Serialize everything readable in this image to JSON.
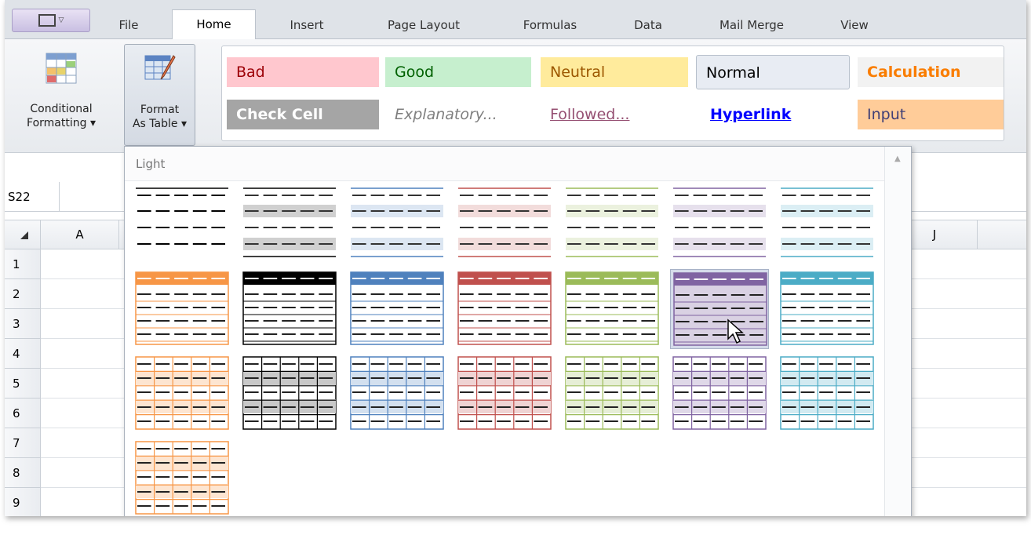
{
  "app_button": {
    "icon": "application-menu-icon"
  },
  "tabs": [
    {
      "label": "File",
      "active": false
    },
    {
      "label": "Home",
      "active": true
    },
    {
      "label": "Insert",
      "active": false
    },
    {
      "label": "Page Layout",
      "active": false
    },
    {
      "label": "Formulas",
      "active": false
    },
    {
      "label": "Data",
      "active": false
    },
    {
      "label": "Mail Merge",
      "active": false
    },
    {
      "label": "View",
      "active": false
    }
  ],
  "ribbon": {
    "conditional_formatting": {
      "line1": "Conditional",
      "line2": "Formatting ▾"
    },
    "format_as_table": {
      "line1": "Format",
      "line2": "As Table ▾"
    },
    "cell_styles": [
      {
        "label": "Bad",
        "bg": "#ffc7ce",
        "color": "#9c0006"
      },
      {
        "label": "Good",
        "bg": "#c6efce",
        "color": "#006100"
      },
      {
        "label": "Neutral",
        "bg": "#ffeb9c",
        "color": "#9c5700"
      },
      {
        "label": "Normal",
        "bg": "#e8ecf3",
        "color": "#000000"
      },
      {
        "label": "Calculation",
        "bg": "#f2f2f2",
        "color": "#fa7d00"
      },
      {
        "label": "Check Cell",
        "bg": "#a5a5a5",
        "color": "#ffffff"
      },
      {
        "label": "Explanatory...",
        "bg": "#ffffff",
        "color": "#7f7f7f"
      },
      {
        "label": "Followed...",
        "bg": "#ffffff",
        "color": "#954f72"
      },
      {
        "label": "Hyperlink",
        "bg": "#ffffff",
        "color": "#0000ff"
      },
      {
        "label": "Input",
        "bg": "#ffcc99",
        "color": "#3f3f76"
      }
    ]
  },
  "name_box": {
    "value": "S22"
  },
  "columns": {
    "first": "A",
    "last": "J"
  },
  "rows": [
    "1",
    "2",
    "3",
    "4",
    "5",
    "6",
    "7",
    "8",
    "9"
  ],
  "gallery": {
    "section_label": "Light",
    "colors": [
      "#000000",
      "#4f81bd",
      "#c0504d",
      "#9bbb59",
      "#8064a2",
      "#4bacc6",
      "#f79646"
    ],
    "hovered_style": "light-row2-col6"
  }
}
